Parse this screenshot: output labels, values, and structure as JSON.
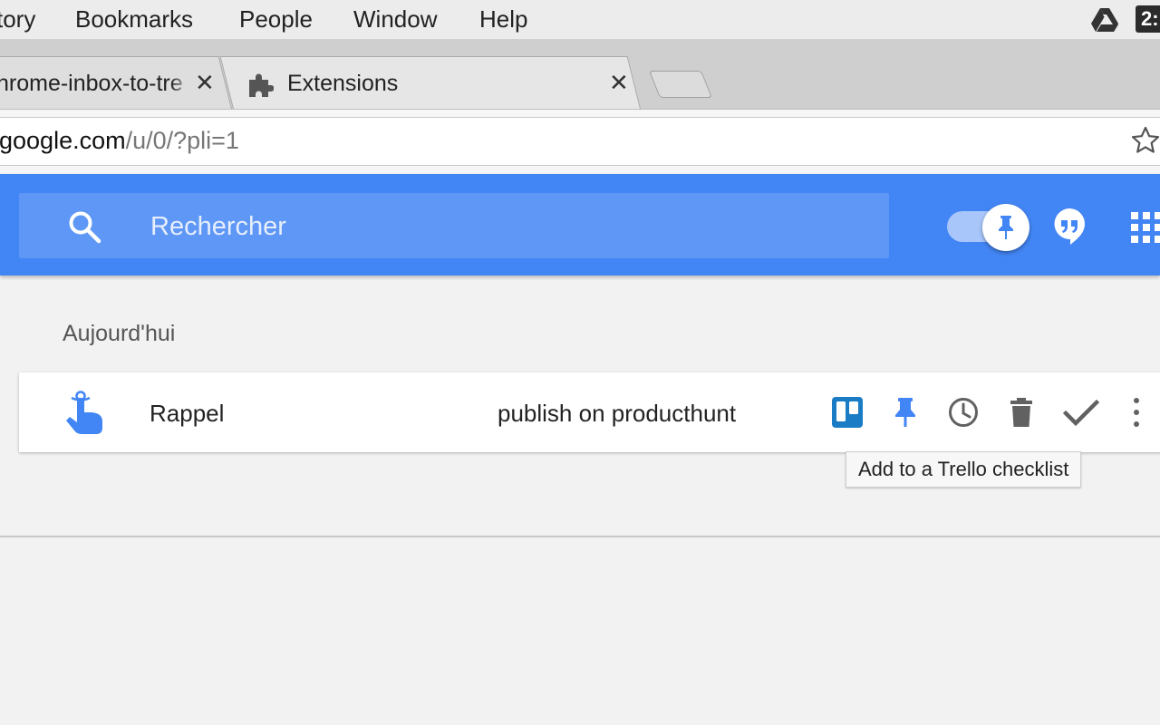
{
  "menubar": {
    "items": [
      "tory",
      "Bookmarks",
      "People",
      "Window",
      "Help"
    ],
    "badge": "2:"
  },
  "tabs": [
    {
      "label": "hrome-inbox-to-tre",
      "close": "✕"
    },
    {
      "label": "Extensions",
      "close": "✕"
    }
  ],
  "address": {
    "host": "google.com",
    "path": "/u/0/?pli=1"
  },
  "header": {
    "search_placeholder": "Rechercher",
    "brand_color": "#4285f4"
  },
  "content": {
    "section_title": "Aujourd'hui",
    "item": {
      "sender": "Rappel",
      "subject": "publish on producthunt",
      "actions": [
        "trello-icon",
        "pin-icon",
        "snooze-icon",
        "trash-icon",
        "done-icon",
        "more-icon"
      ]
    },
    "tooltip": "Add to a Trello checklist"
  }
}
